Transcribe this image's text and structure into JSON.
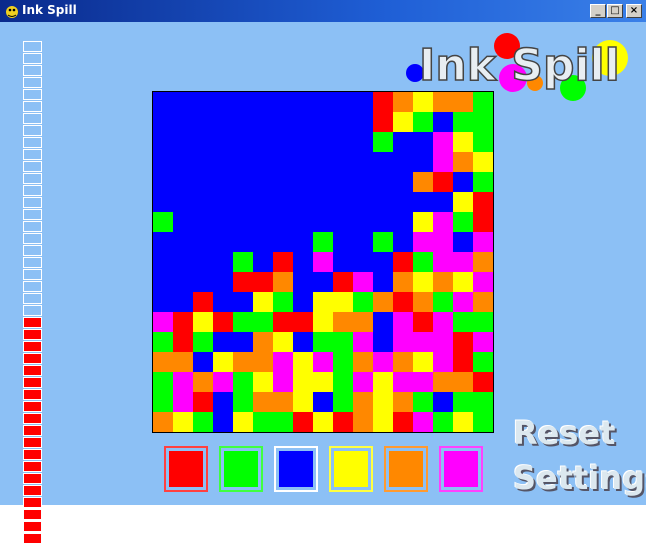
{
  "window": {
    "title": "Ink Spill",
    "controls": [
      "_",
      "□",
      "×"
    ]
  },
  "title_logo": {
    "text": "Ink Spill"
  },
  "menu": {
    "reset": "Reset",
    "settings": "Settings"
  },
  "moves": {
    "total": 42,
    "used": 23,
    "remaining": 19
  },
  "palette": [
    {
      "name": "red",
      "fill": "#ff0000",
      "border": "#ff4040"
    },
    {
      "name": "green",
      "fill": "#00ff00",
      "border": "#40ff40"
    },
    {
      "name": "blue",
      "fill": "#0000ff",
      "border": "#ffffff"
    },
    {
      "name": "yellow",
      "fill": "#ffff00",
      "border": "#ffff40"
    },
    {
      "name": "orange",
      "fill": "#ff8800",
      "border": "#ff9a30"
    },
    {
      "name": "purple",
      "fill": "#ff00ff",
      "border": "#ff40ff"
    }
  ],
  "board": {
    "size": 17,
    "colors": {
      "B": "#0000ff",
      "R": "#ff0000",
      "G": "#00ff00",
      "Y": "#ffff00",
      "O": "#ff8800",
      "P": "#ff00ff"
    },
    "rows": [
      "BBBBBBBBBBBROYOOG",
      "BBBBBBBBBBBRYGBGG",
      "BBBBBBBBBBBGBBPYG",
      "BBBBBBBBBBBBBBPOY",
      "BBBBBBBBBBBBBORBG",
      "BBBBBBBBBBBBBBBYR",
      "GBBBBBBBBBBBBYPGR",
      "BBBBBBBBGBBGBPPBP",
      "BBBBGBRBPBBBRGPPO",
      "BBBBRROBBRPBOYOYP",
      "BBRBBYGBYYGOROGPO",
      "PRYRGGRRYOOBPRPGG",
      "GRGBBOYBGGPBPPPRP",
      "OOBYOOPYPGOPOYPRG",
      "GPOPGYPYYGPYPPOOR",
      "GPRBGOOYBGOYOGBGG",
      "OYGBYGGRYROYRPGYG"
    ]
  }
}
